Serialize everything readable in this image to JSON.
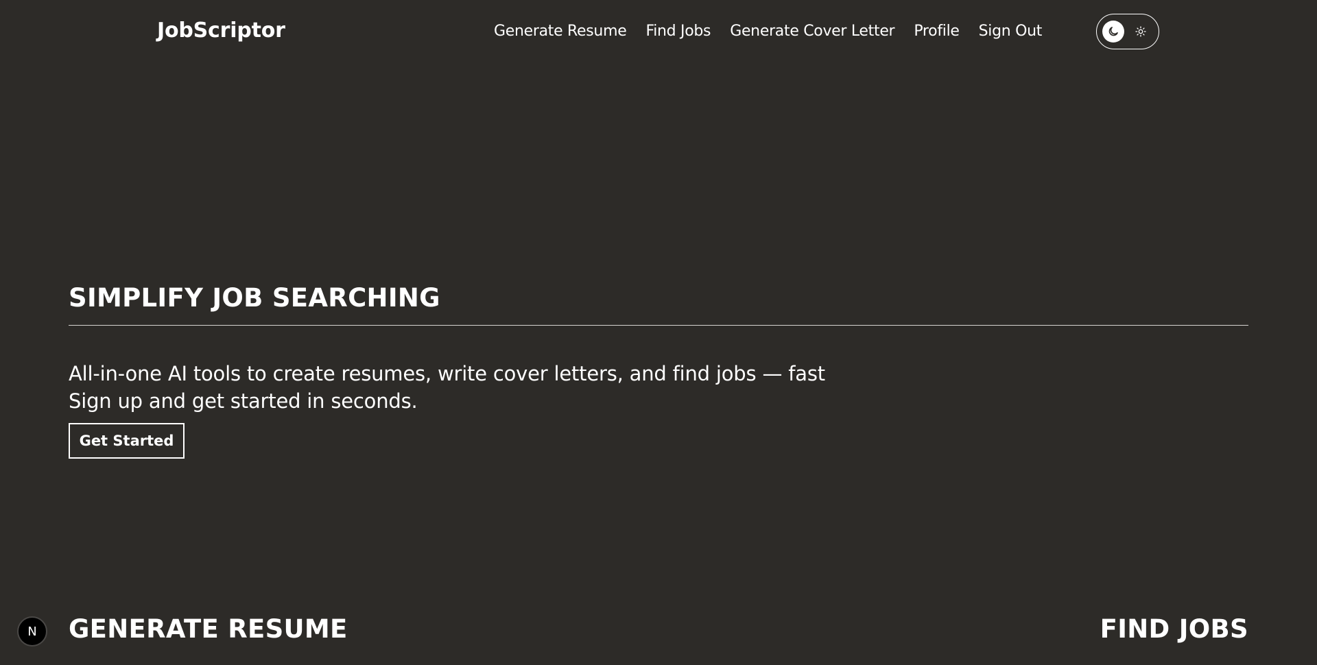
{
  "header": {
    "brand": "JobScriptor",
    "nav": [
      {
        "label": "Generate Resume"
      },
      {
        "label": "Find Jobs"
      },
      {
        "label": "Generate Cover Letter"
      },
      {
        "label": "Profile"
      },
      {
        "label": "Sign Out"
      }
    ],
    "theme_toggle": {
      "active_icon": "moon-icon",
      "inactive_icon": "sun-icon"
    }
  },
  "hero": {
    "title": "SIMPLIFY JOB SEARCHING",
    "line1": "All-in-one AI tools to create resumes, write cover letters, and find jobs — fast",
    "line2": "Sign up and get started in seconds.",
    "cta_label": "Get Started"
  },
  "sections": {
    "left_title": "GENERATE RESUME",
    "right_title": "FIND JOBS"
  },
  "badge": {
    "letter": "N"
  },
  "colors": {
    "background": "#2d2b28",
    "foreground": "#ffffff"
  }
}
